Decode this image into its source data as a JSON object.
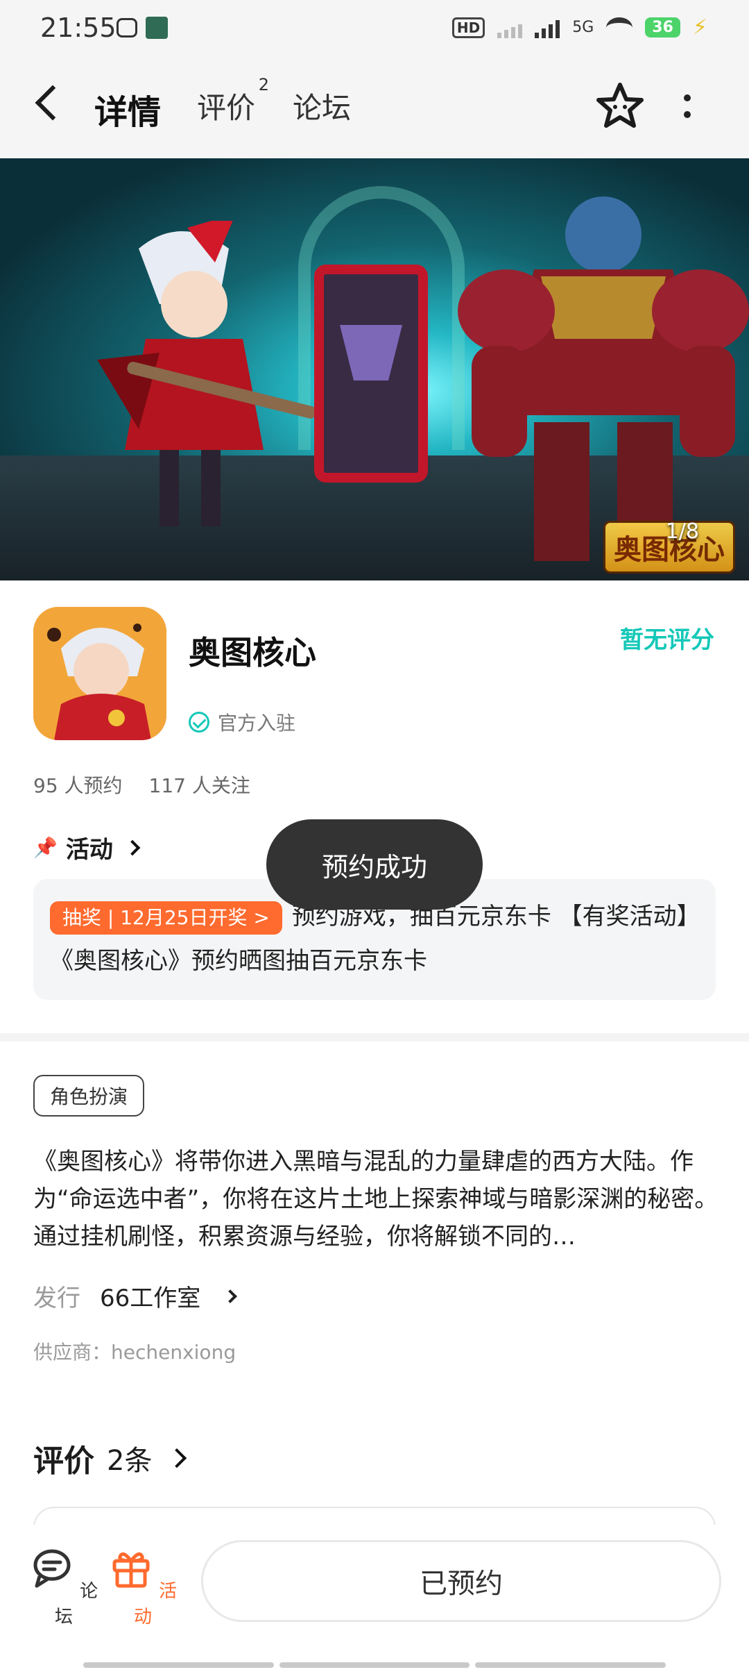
{
  "status_bar": {
    "time": "21:55",
    "network": "5G",
    "battery": "36"
  },
  "nav": {
    "tabs": {
      "detail": "详情",
      "reviews": "评价",
      "forum": "论坛"
    },
    "reviews_badge": "2"
  },
  "banner": {
    "pager": "1/8",
    "logo_text": "奥图核心"
  },
  "game": {
    "name": "奥图核心",
    "official": "官方入驻",
    "rating": "暂无评分",
    "reservations": "95 人预约",
    "followers": "117 人关注"
  },
  "activity": {
    "header": "活动",
    "tag": "抽奖 | 12月25日开奖 >",
    "text": "预约游戏，抽百元京东卡 【有奖活动】《奥图核心》预约晒图抽百元京东卡"
  },
  "toast": "预约成功",
  "about": {
    "genre": "角色扮演",
    "description": "《奥图核心》将带你进入黑暗与混乱的力量肆虐的西方大陆。作为“命运选中者”，你将在这片土地上探索神域与暗影深渊的秘密。通过挂机刷怪，积累资源与经验，你将解锁不同的…",
    "publisher_label": "发行",
    "publisher": "66工作室",
    "supplier": "供应商：hechenxiong"
  },
  "reviews": {
    "title": "评价",
    "count": "2条"
  },
  "bottom_bar": {
    "forum": "论坛",
    "activity": "活动",
    "reserve_button": "已预约"
  },
  "colors": {
    "accent": "#14c8b8",
    "orange": "#ff6a2e"
  }
}
